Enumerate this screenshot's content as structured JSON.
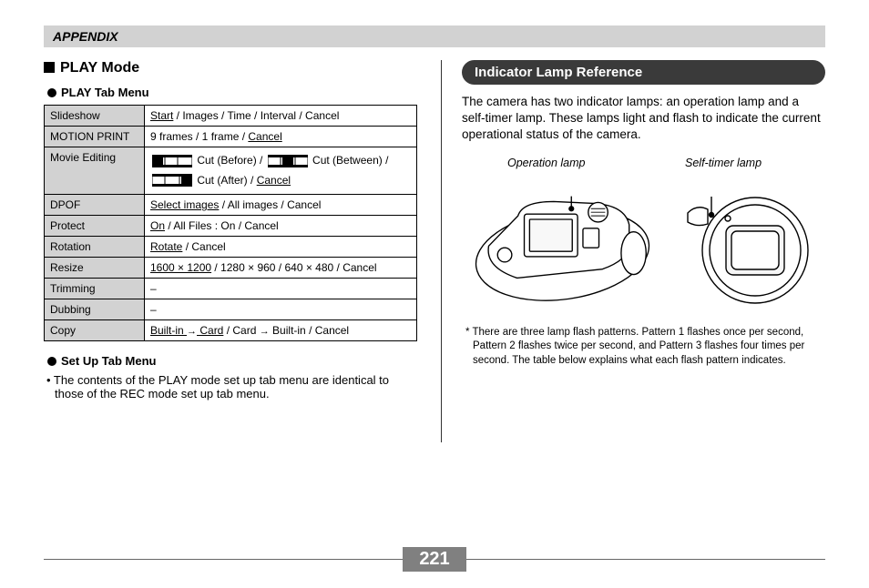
{
  "appendix": "APPENDIX",
  "play_mode": {
    "heading": "PLAY Mode",
    "tab_menu_heading": "PLAY Tab Menu",
    "rows": {
      "slideshow": {
        "label": "Slideshow",
        "opt_u": "Start",
        "rest": " / Images / Time / Interval / Cancel"
      },
      "motionprint": {
        "label": "MOTION PRINT",
        "text": "9 frames / 1 frame / ",
        "cancel": "Cancel"
      },
      "movieedit": {
        "label": "Movie Editing",
        "before": " Cut (Before) / ",
        "between": " Cut (Between) / ",
        "after": " Cut (After) / ",
        "cancel": "Cancel"
      },
      "dpof": {
        "label": "DPOF",
        "opt_u": "Select images",
        "rest": " / All images / Cancel"
      },
      "protect": {
        "label": "Protect",
        "opt_u": "On",
        "rest": " / All Files : On / Cancel"
      },
      "rotation": {
        "label": "Rotation",
        "opt_u": "Rotate",
        "rest": " / Cancel"
      },
      "resize": {
        "label": "Resize",
        "opt_u": "1600 × 1200",
        "rest": " / 1280 × 960 / 640 × 480 / Cancel"
      },
      "trimming": {
        "label": "Trimming",
        "text": "–"
      },
      "dubbing": {
        "label": "Dubbing",
        "text": "–"
      },
      "copy": {
        "label": "Copy",
        "p1_u": "Built-in ",
        "p1_arrow": "→",
        "p1_rest": " Card",
        "sep": " / Card ",
        "p2_arrow": "→",
        "p2_rest": " Built-in / Cancel"
      }
    },
    "setup_heading": "Set Up Tab Menu",
    "setup_note": "• The contents of the PLAY mode set up tab menu are identical to those of the REC mode set up tab menu."
  },
  "indicator": {
    "heading": "Indicator Lamp Reference",
    "para": "The camera has two indicator lamps: an operation lamp and a self-timer lamp. These lamps light and flash to indicate the current operational status of the camera.",
    "operation_label": "Operation lamp",
    "selftimer_label": "Self-timer lamp",
    "footnote": "* There are three lamp flash patterns. Pattern 1 flashes once per second, Pattern 2 flashes twice per second, and Pattern 3 flashes four times per second. The table below explains what each flash pattern indicates."
  },
  "page_number": "221"
}
